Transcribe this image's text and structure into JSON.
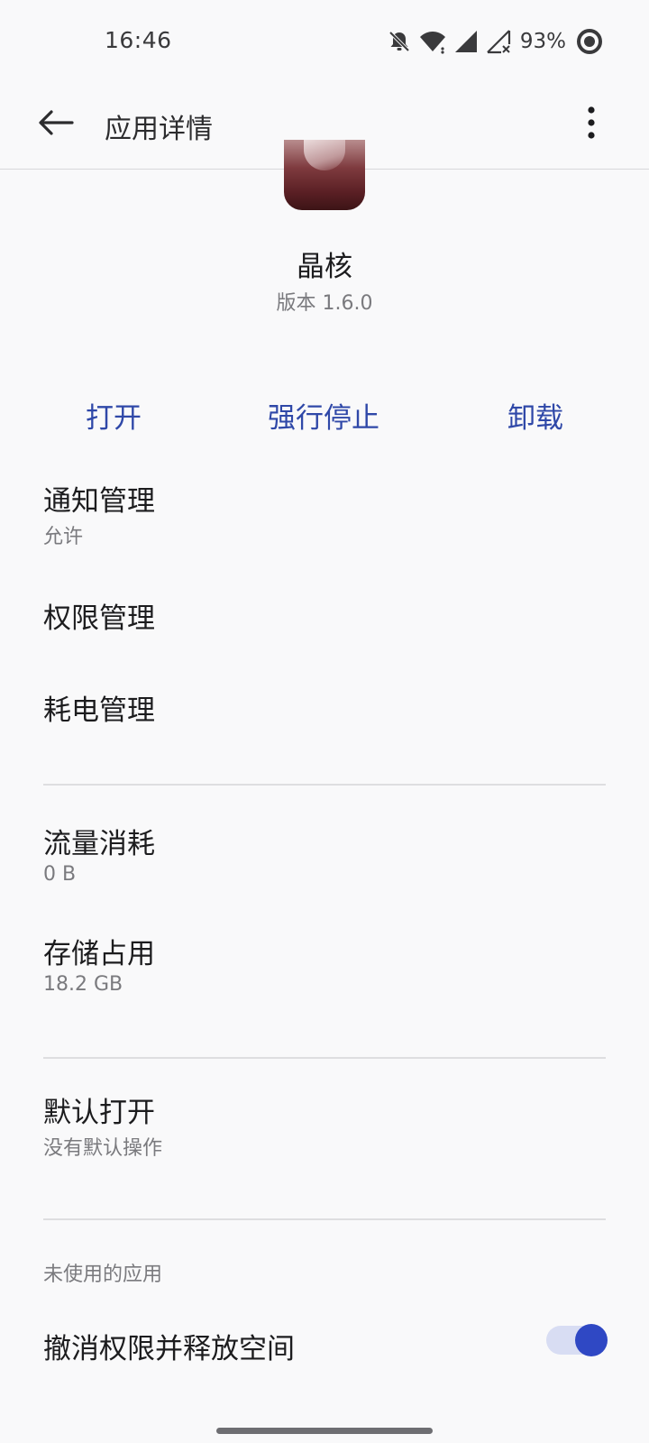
{
  "status_bar": {
    "time": "16:46",
    "battery_percent": "93%",
    "icons": [
      "bell-off-icon",
      "wifi-icon",
      "cell-signal-icon",
      "cell-signal-off-icon",
      "battery-ring-icon"
    ]
  },
  "app_bar": {
    "title": "应用详情",
    "back_icon": "arrow-left-icon",
    "more_icon": "more-vertical-icon"
  },
  "app": {
    "name": "晶核",
    "version": "版本 1.6.0"
  },
  "actions": {
    "open": "打开",
    "force_stop": "强行停止",
    "uninstall": "卸载"
  },
  "items": {
    "notifications": {
      "title": "通知管理",
      "subtitle": "允许"
    },
    "permissions": {
      "title": "权限管理"
    },
    "battery": {
      "title": "耗电管理"
    },
    "data_usage": {
      "title": "流量消耗",
      "subtitle": "0 B"
    },
    "storage": {
      "title": "存储占用",
      "subtitle": "18.2 GB"
    },
    "default_open": {
      "title": "默认打开",
      "subtitle": "没有默认操作"
    }
  },
  "unused_apps": {
    "header": "未使用的应用",
    "revoke_label": "撤消权限并释放空间",
    "revoke_enabled": true
  },
  "colors": {
    "accent": "#2f48a8",
    "toggle_on": "#2f48c4",
    "background": "#f9f9fa"
  }
}
